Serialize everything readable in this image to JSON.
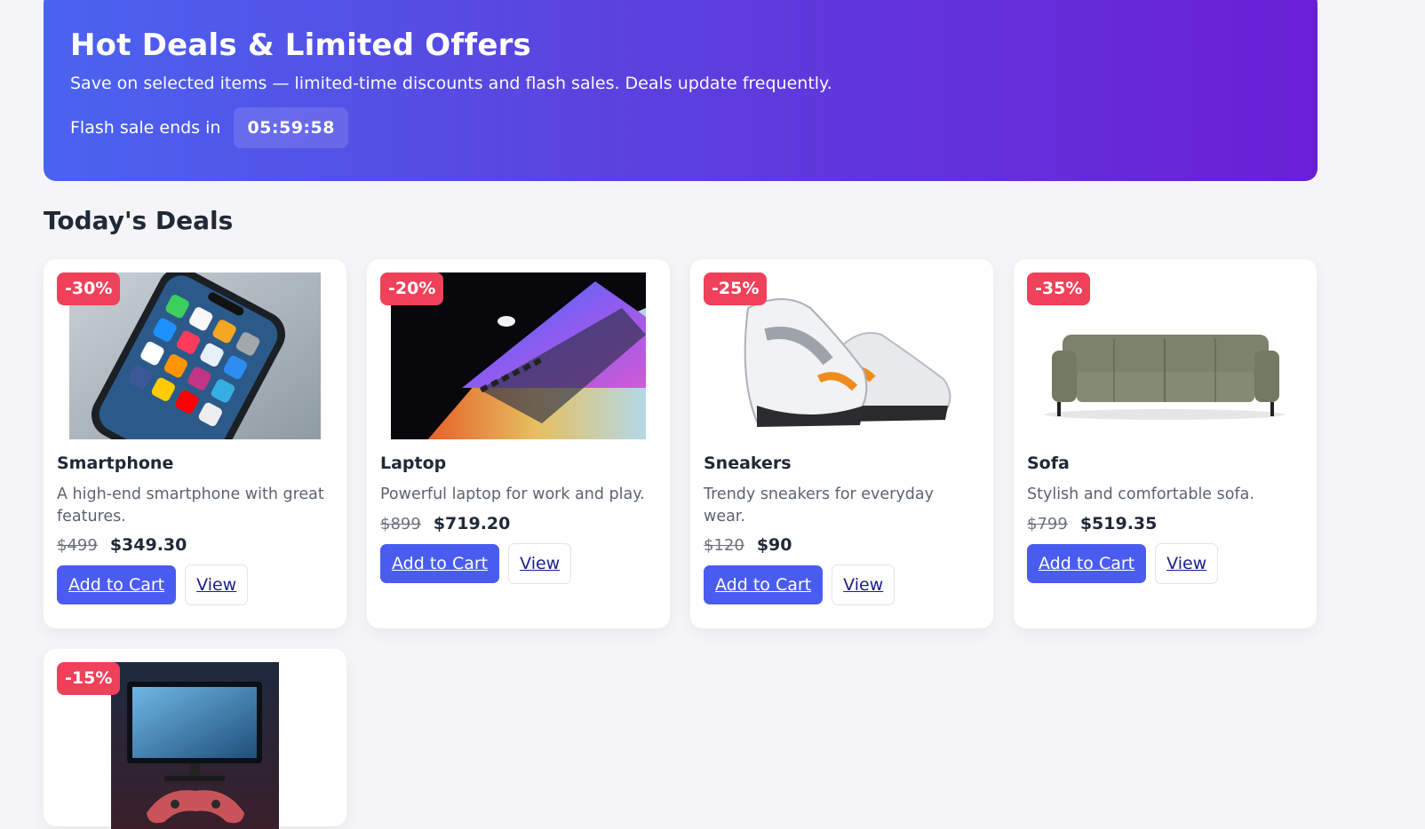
{
  "hero": {
    "title": "Hot Deals & Limited Offers",
    "subtitle": "Save on selected items — limited-time discounts and flash sales. Deals update frequently.",
    "timer_label": "Flash sale ends in",
    "timer_value": "05:59:58",
    "gradient_start": "#4a63f0",
    "gradient_end": "#6a1fd6"
  },
  "section": {
    "title": "Today's Deals"
  },
  "colors": {
    "badge": "#ef4159",
    "primary_button": "#4a5cf0"
  },
  "buttons": {
    "add_to_cart": "Add to Cart",
    "view": "View"
  },
  "products": [
    {
      "discount": "-30%",
      "name": "Smartphone",
      "description": "A high-end smartphone with great features.",
      "old_price": "$499",
      "new_price": "$349.30",
      "image": "smartphone-photo"
    },
    {
      "discount": "-20%",
      "name": "Laptop",
      "description": "Powerful laptop for work and play.",
      "old_price": "$899",
      "new_price": "$719.20",
      "image": "laptop-photo"
    },
    {
      "discount": "-25%",
      "name": "Sneakers",
      "description": "Trendy sneakers for everyday wear.",
      "old_price": "$120",
      "new_price": "$90",
      "image": "sneakers-photo"
    },
    {
      "discount": "-35%",
      "name": "Sofa",
      "description": "Stylish and comfortable sofa.",
      "old_price": "$799",
      "new_price": "$519.35",
      "image": "sofa-photo"
    },
    {
      "discount": "-15%",
      "image": "gaming-setup-photo"
    }
  ]
}
